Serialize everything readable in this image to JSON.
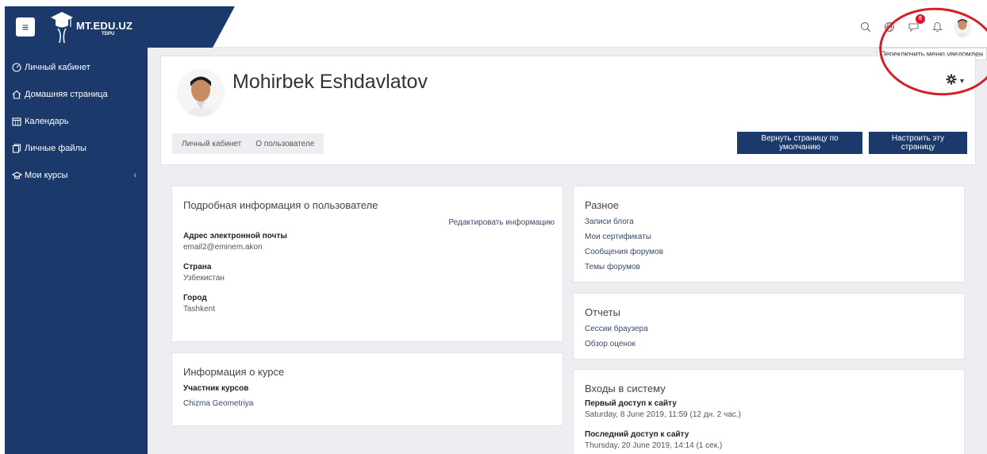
{
  "brand": {
    "title": "MT.EDU.UZ",
    "subtitle": "TDPU"
  },
  "topbar": {
    "notification_count": "0",
    "tooltip": "Переключить меню уведомлен"
  },
  "sidebar": {
    "items": [
      {
        "label": "Личный кабинет",
        "icon": "dashboard-icon"
      },
      {
        "label": "Домашняя страница",
        "icon": "home-icon"
      },
      {
        "label": "Календарь",
        "icon": "calendar-icon"
      },
      {
        "label": "Личные файлы",
        "icon": "files-icon"
      },
      {
        "label": "Мои курсы",
        "icon": "graduation-cap-icon",
        "chevron": "‹"
      }
    ]
  },
  "profile": {
    "name": "Mohirbek Eshdavlatov",
    "breadcrumb": [
      "Личный кабинет",
      "О пользователе"
    ],
    "reset_button": "Вернуть страницу по умолчанию",
    "customize_button": "Настроить эту страницу"
  },
  "user_details": {
    "title": "Подробная информация о пользователе",
    "edit_link": "Редактировать информацию",
    "email_label": "Адрес электронной почты",
    "email_value": "email2@eminem.akon",
    "country_label": "Страна",
    "country_value": "Узбекистан",
    "city_label": "Город",
    "city_value": "Tashkent"
  },
  "course_details": {
    "title": "Информация о курсе",
    "participant_label": "Участник курсов",
    "course_link": "Chizma Geometriya"
  },
  "misc": {
    "title": "Разное",
    "links": [
      "Записи блога",
      "Мои сертификаты",
      "Сообщения форумов",
      "Темы форумов"
    ]
  },
  "reports": {
    "title": "Отчеты",
    "links": [
      "Сессии браузера",
      "Обзор оценок"
    ]
  },
  "logins": {
    "title": "Входы в систему",
    "first_label": "Первый доступ к сайту",
    "first_value": "Saturday, 8 June 2019, 11:59  (12 дн. 2 час.)",
    "last_label": "Последний доступ к сайту",
    "last_value": "Thursday, 20 June 2019, 14:14  (1 сек.)"
  },
  "colors": {
    "navy": "#1b3a6b",
    "badge": "#e0112b",
    "annotation": "#d61e2a"
  }
}
